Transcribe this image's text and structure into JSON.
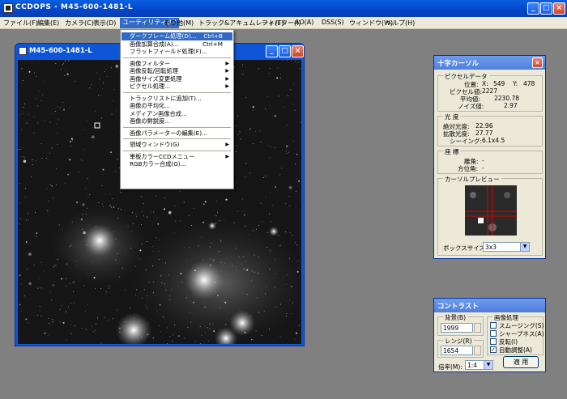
{
  "app": {
    "title": "CCDOPS - M45-600-1481-L",
    "min": "_",
    "max": "□",
    "close": "×"
  },
  "menubar": [
    "ファイル(F)",
    "編集(E)",
    "カメラ(C)",
    "表示(D)",
    "ユーティリティ(U)",
    "その他(M)",
    "トラック&アキュムレート(T)",
    "フィルター(I)",
    "AO(A)",
    "DSS(S)",
    "ウィンドウ(W)",
    "ヘルプ(H)"
  ],
  "image_window": {
    "title": "M45-600-1481-L"
  },
  "dropdown": [
    {
      "label": "ダークフレーム処理(D)...",
      "shortcut": "Ctrl+B",
      "highlight": true
    },
    {
      "label": "画像加算合成(A)...",
      "shortcut": "Ctrl+M"
    },
    {
      "label": "フラットフィールド処理(F)..."
    },
    {
      "sep": true
    },
    {
      "label": "画像フィルター",
      "sub": true
    },
    {
      "label": "画像反転/回転処理",
      "sub": true
    },
    {
      "label": "画像サイズ変更処理",
      "sub": true
    },
    {
      "label": "ピクセル処理...",
      "sub": true
    },
    {
      "sep": true
    },
    {
      "label": "トラックリストに追加(T)..."
    },
    {
      "label": "画像の平均化..."
    },
    {
      "label": "メディアン画像合成..."
    },
    {
      "label": "画像の鮮鋭度..."
    },
    {
      "sep": true
    },
    {
      "label": "画像パラメーターの編集(E)..."
    },
    {
      "sep": true
    },
    {
      "label": "領域ウィンドウ(G)",
      "sub": true
    },
    {
      "sep": true
    },
    {
      "label": "単板カラーCCDメニュー",
      "sub": true
    },
    {
      "label": "RGBカラー合成(G)..."
    }
  ],
  "cursor_panel": {
    "title": "十字カーソル",
    "pixel_data_label": "ピクセルデータ",
    "position_label": "位置:",
    "x_label": "X:",
    "x_value": "549",
    "y_label": "Y:",
    "y_value": "478",
    "pixel_value_label": "ピクセル値:",
    "pixel_value": "2227",
    "average_label": "平均値:",
    "average": "2230.78",
    "noise_label": "ノイズ値:",
    "noise": "2.97",
    "photometry_label": "光 度",
    "abs_mag_label": "絶対光度:",
    "abs_mag": "22.96",
    "ext_mag_label": "拡散光度:",
    "ext_mag": "27.77",
    "seeing_label": "シーイング:",
    "seeing": "6.1x4.5",
    "coords_label": "座 標",
    "ra_label": "離角:",
    "ra": "-",
    "dec_label": "方位角:",
    "dec": "-",
    "preview_label": "カーソルプレビュー",
    "box_size_label": "ボックスサイズ:",
    "box_size": "3x3"
  },
  "contrast_panel": {
    "title": "コントラスト",
    "background_label": "背景(B)",
    "background": "1999",
    "range_label": "レンジ(R)",
    "range": "1654",
    "processing_label": "画像処理",
    "smoothing_label": "スムージング(S)",
    "smoothing": false,
    "sharpness_label": "シャープネス(A)",
    "sharpness": false,
    "invert_label": "反転(I)",
    "invert": false,
    "auto_label": "自動調整(A)",
    "auto": true,
    "zoom_label": "倍率(M):",
    "zoom": "1:4",
    "apply_label": "適 用"
  }
}
